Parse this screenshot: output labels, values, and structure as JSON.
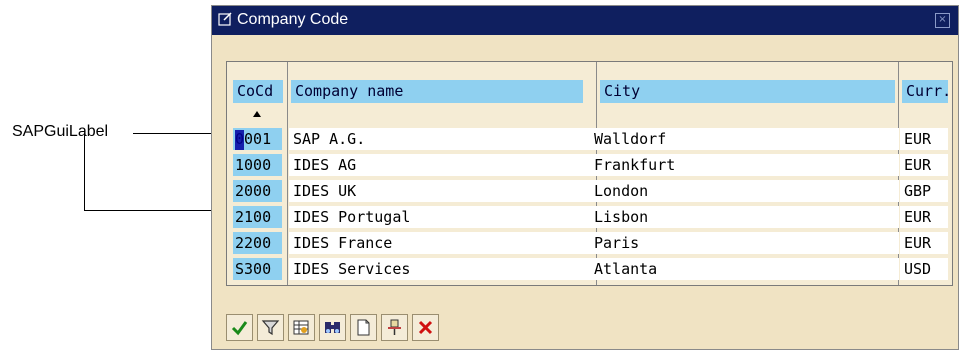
{
  "callout": {
    "label": "SAPGuiLabel"
  },
  "dialog": {
    "title": "Company Code"
  },
  "table": {
    "columns": [
      "CoCd",
      "Company name",
      "City",
      "Curr."
    ],
    "rows": [
      [
        "0001",
        "SAP A.G.",
        "Walldorf",
        "EUR"
      ],
      [
        "1000",
        "IDES AG",
        "Frankfurt",
        "EUR"
      ],
      [
        "2000",
        "IDES UK",
        "London",
        "GBP"
      ],
      [
        "2100",
        "IDES Portugal",
        "Lisbon",
        "EUR"
      ],
      [
        "2200",
        "IDES France",
        "Paris",
        "EUR"
      ],
      [
        "S300",
        "IDES Services",
        "Atlanta",
        "USD"
      ]
    ]
  },
  "toolbar": {
    "buttons": [
      "check-icon",
      "filter-icon",
      "new-entries-icon",
      "find-icon",
      "new-page-icon",
      "pin-icon",
      "cancel-icon"
    ]
  },
  "colors": {
    "titlebar": "#0f1f5f",
    "header_bg": "#8fd0f0",
    "window_bg": "#f0e3c3",
    "cancel_red": "#d01010",
    "check_green": "#1a8a1a"
  }
}
